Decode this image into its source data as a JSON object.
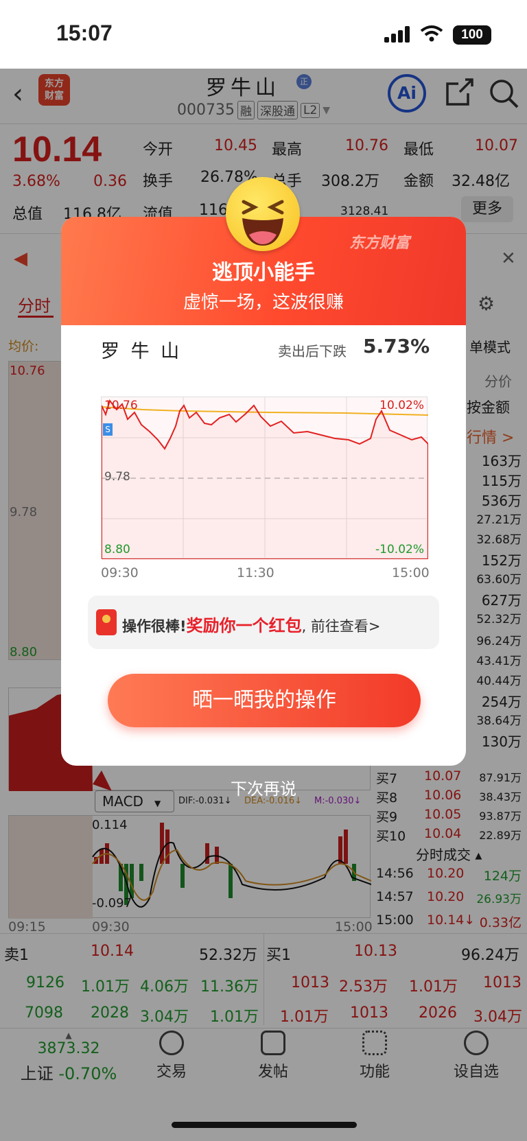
{
  "status": {
    "time": "15:07",
    "battery": "100"
  },
  "stock": {
    "name": "罗牛山",
    "code": "000735",
    "tags": [
      "融",
      "深股通",
      "L2"
    ],
    "logo": "东方\n财富"
  },
  "quote": {
    "price": "10.14",
    "pct": "3.68%",
    "chg": "0.36",
    "rows": [
      {
        "k1": "今开",
        "v1": "10.45",
        "k2": "最高",
        "v2": "10.76",
        "k3": "最低",
        "v3": "10.07"
      },
      {
        "k1": "换手",
        "v1": "26.78%",
        "k2": "总手",
        "v2": "308.2万",
        "k3": "金额",
        "v3": "32.48亿"
      },
      {
        "k1": "总值",
        "v1": "116.8亿",
        "k2": "流值",
        "v2": "116",
        "k3": "",
        "v3": "3128.41"
      }
    ],
    "more": "更多"
  },
  "tabs": {
    "intraday": "分时",
    "avg": "均价:"
  },
  "left_chart": {
    "top": "10.76",
    "mid": "9.78",
    "bottom": "8.80",
    "start": "09:15",
    "open": "09:30",
    "end": "15:00"
  },
  "macd": {
    "label": "MACD",
    "dif": "DIF:-0.031↓",
    "dea": "DEA:-0.016↓",
    "m": "M:-0.030↓",
    "top": "0.114",
    "bottom": "-0.097"
  },
  "right_panel": {
    "mode": "单模式",
    "price": "分价",
    "amount": "按金额",
    "quote_link": "行情 >",
    "vols": [
      "163万",
      "115万",
      "536万",
      "27.21万",
      "32.68万",
      "152万",
      "63.60万",
      "627万",
      "52.32万",
      "96.24万",
      "43.41万",
      "40.44万",
      "254万",
      "38.64万",
      "130万"
    ],
    "bids": [
      {
        "k": "买7",
        "p": "10.07",
        "v": "87.91万"
      },
      {
        "k": "买8",
        "p": "10.06",
        "v": "38.43万"
      },
      {
        "k": "买9",
        "p": "10.05",
        "v": "93.87万"
      },
      {
        "k": "买10",
        "p": "10.04",
        "v": "22.89万"
      }
    ],
    "ticks_title": "分时成交",
    "ticks": [
      {
        "t": "14:56",
        "p": "10.20",
        "v": "124万"
      },
      {
        "t": "14:57",
        "p": "10.20",
        "v": "26.93万"
      },
      {
        "t": "15:00",
        "p": "10.14↓",
        "v": "0.33亿"
      }
    ]
  },
  "book": {
    "sell1": "卖1",
    "sell1p": "10.14",
    "sell1v": "52.32万",
    "buy1": "买1",
    "buy1p": "10.13",
    "buy1v": "96.24万",
    "row1l": [
      "9126",
      "1.01万",
      "4.06万",
      "11.36万"
    ],
    "row1r": [
      "1013",
      "2.53万",
      "1.01万",
      "1013"
    ],
    "row2l": [
      "7098",
      "2028",
      "3.04万",
      "1.01万"
    ],
    "row2r": [
      "1.01万",
      "1013",
      "2026",
      "3.04万"
    ]
  },
  "nav": {
    "index_val": "3873.32",
    "index_name": "上证",
    "index_pct": "-0.70%",
    "items": [
      "交易",
      "发帖",
      "功能",
      "设自选"
    ]
  },
  "popup": {
    "watermark": "东方财富",
    "title": "逃顶小能手",
    "subtitle": "虚惊一场，这波很赚",
    "stock": "罗 牛 山",
    "fall_label": "卖出后下跌",
    "fall_value": "5.73%",
    "chart_top_left": "10.76",
    "chart_top_right": "10.02%",
    "chart_mid": "9.78",
    "chart_bottom_left": "8.80",
    "chart_bottom_right": "-10.02%",
    "t0": "09:30",
    "t1": "11:30",
    "t2": "15:00",
    "reward_a": "操作很棒!",
    "reward_b": "奖励你一个红包",
    "reward_c": ", 前往查看>",
    "share": "晒一晒我的操作",
    "later": "下次再说"
  }
}
